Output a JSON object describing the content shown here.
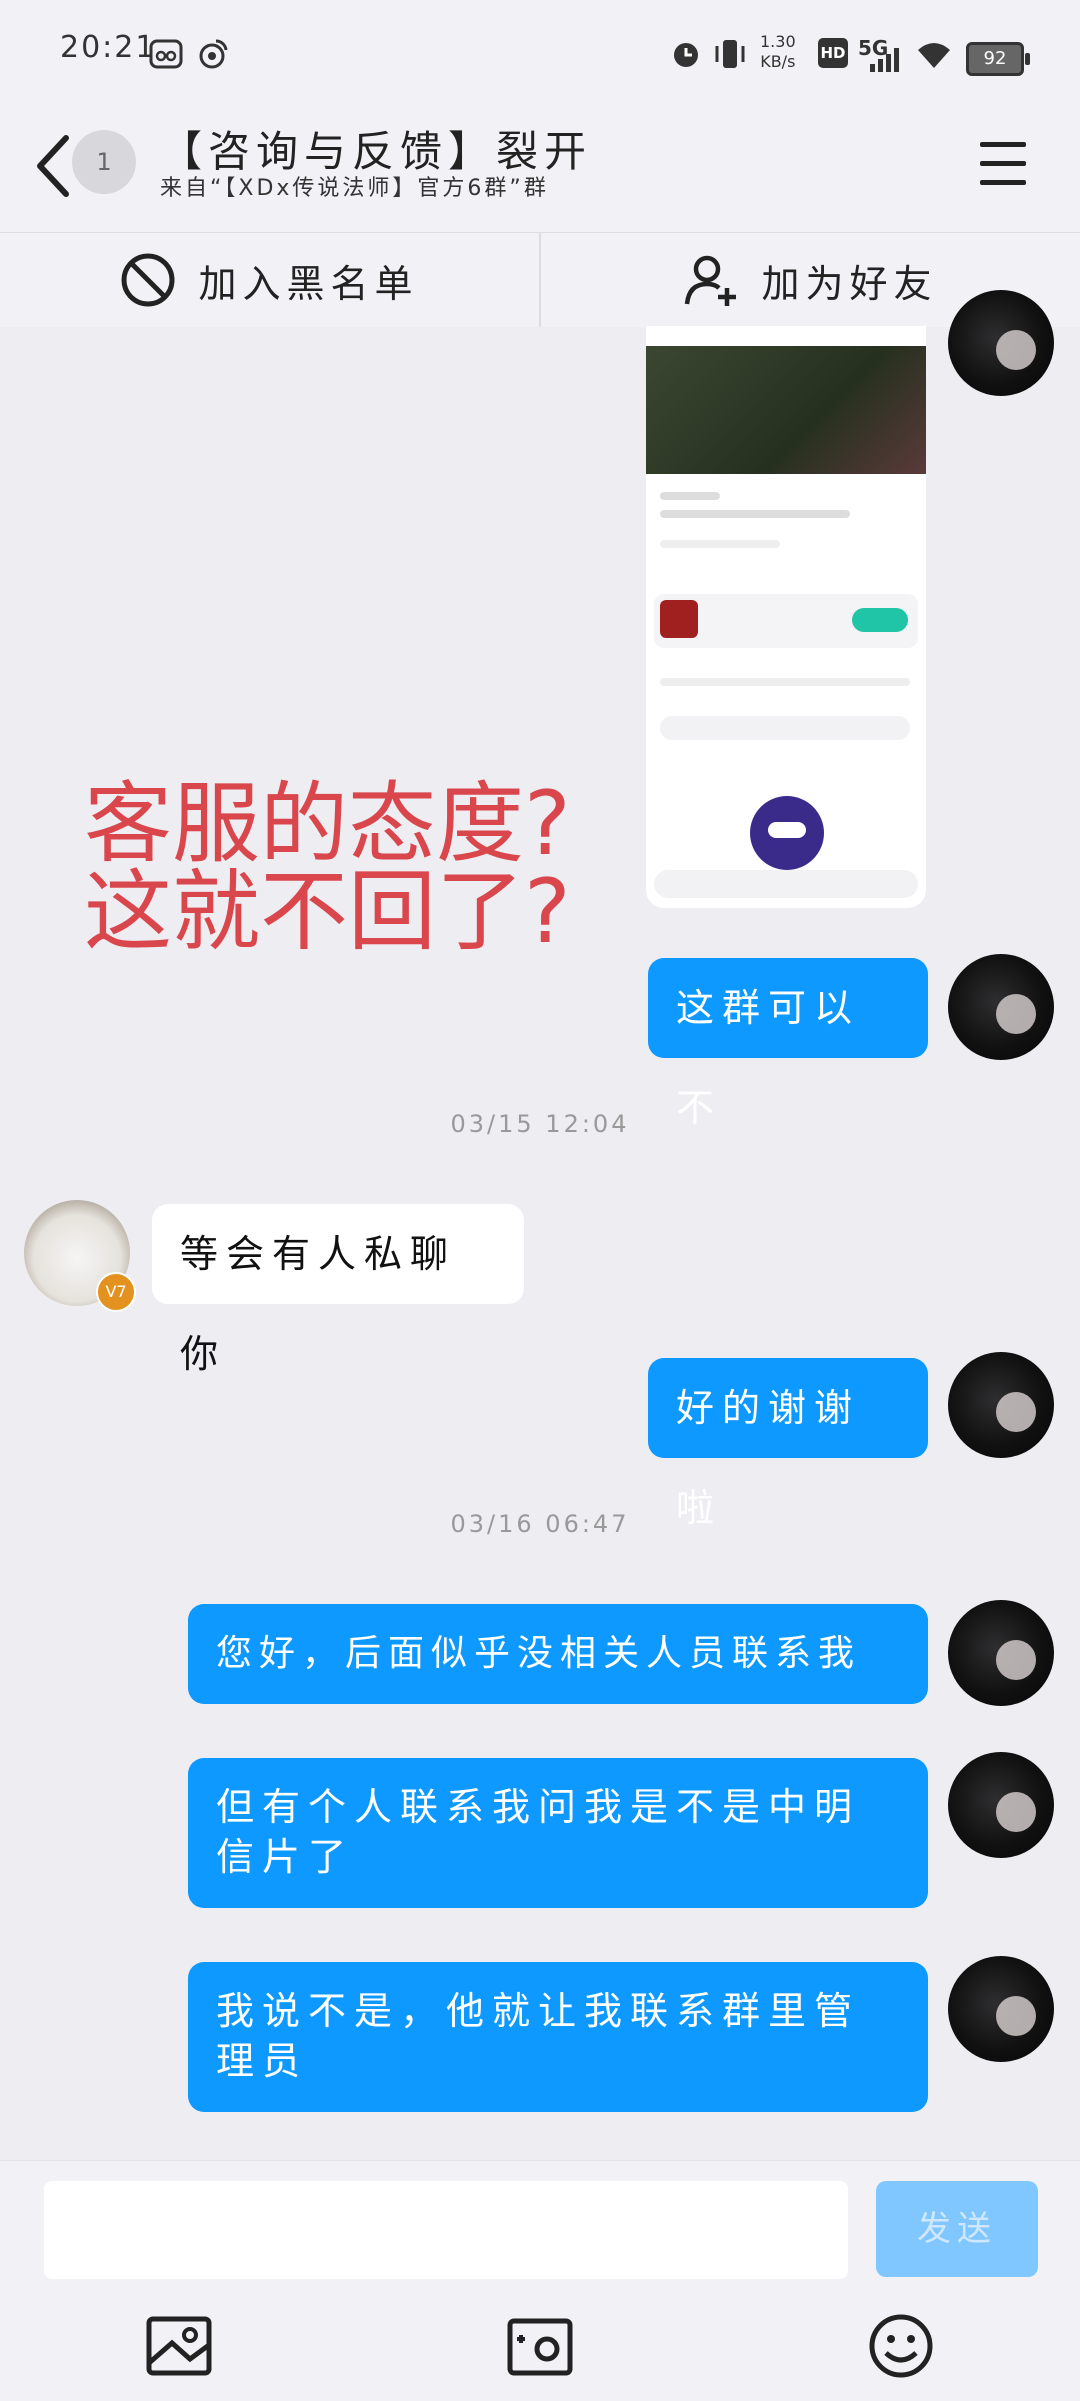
{
  "status_bar": {
    "time": "20:21",
    "speed_value": "1.30",
    "speed_unit": "KB/s",
    "hd": "HD",
    "network": "5G",
    "battery": "92"
  },
  "header": {
    "avatar_text": "1",
    "title": "【咨询与反馈】裂开",
    "subtitle": "来自“【XDx传说法师】官方6群”群"
  },
  "actions": {
    "blacklist": "加入黑名单",
    "add_friend": "加为好友"
  },
  "overlay_text": {
    "line1": "客服的态度?",
    "line2": "这就不回了?"
  },
  "messages": [
    {
      "from": "me",
      "text": "这群可以不"
    },
    {
      "timestamp": "03/15 12:04"
    },
    {
      "from": "other",
      "text": "等会有人私聊你",
      "badge": "V7"
    },
    {
      "from": "me",
      "text": "好的谢谢啦"
    },
    {
      "timestamp": "03/16 06:47"
    },
    {
      "from": "me",
      "text": "您好，后面似乎没相关人员联系我"
    },
    {
      "from": "me",
      "text": "但有个人联系我问我是不是中明信片了"
    },
    {
      "from": "me",
      "text": "我说不是，他就让我联系群里管理员"
    }
  ],
  "composer": {
    "input_value": "",
    "send_label": "发送"
  },
  "icons": {
    "back": "back-arrow-icon",
    "menu": "hamburger-menu-icon",
    "block": "block-icon",
    "add_user": "add-user-icon",
    "image": "image-icon",
    "camera": "camera-icon",
    "emoji": "emoji-icon"
  },
  "colors": {
    "my_bubble": "#0d99ff",
    "overlay_text": "#d9474d",
    "send_button": "#80c6ff"
  }
}
